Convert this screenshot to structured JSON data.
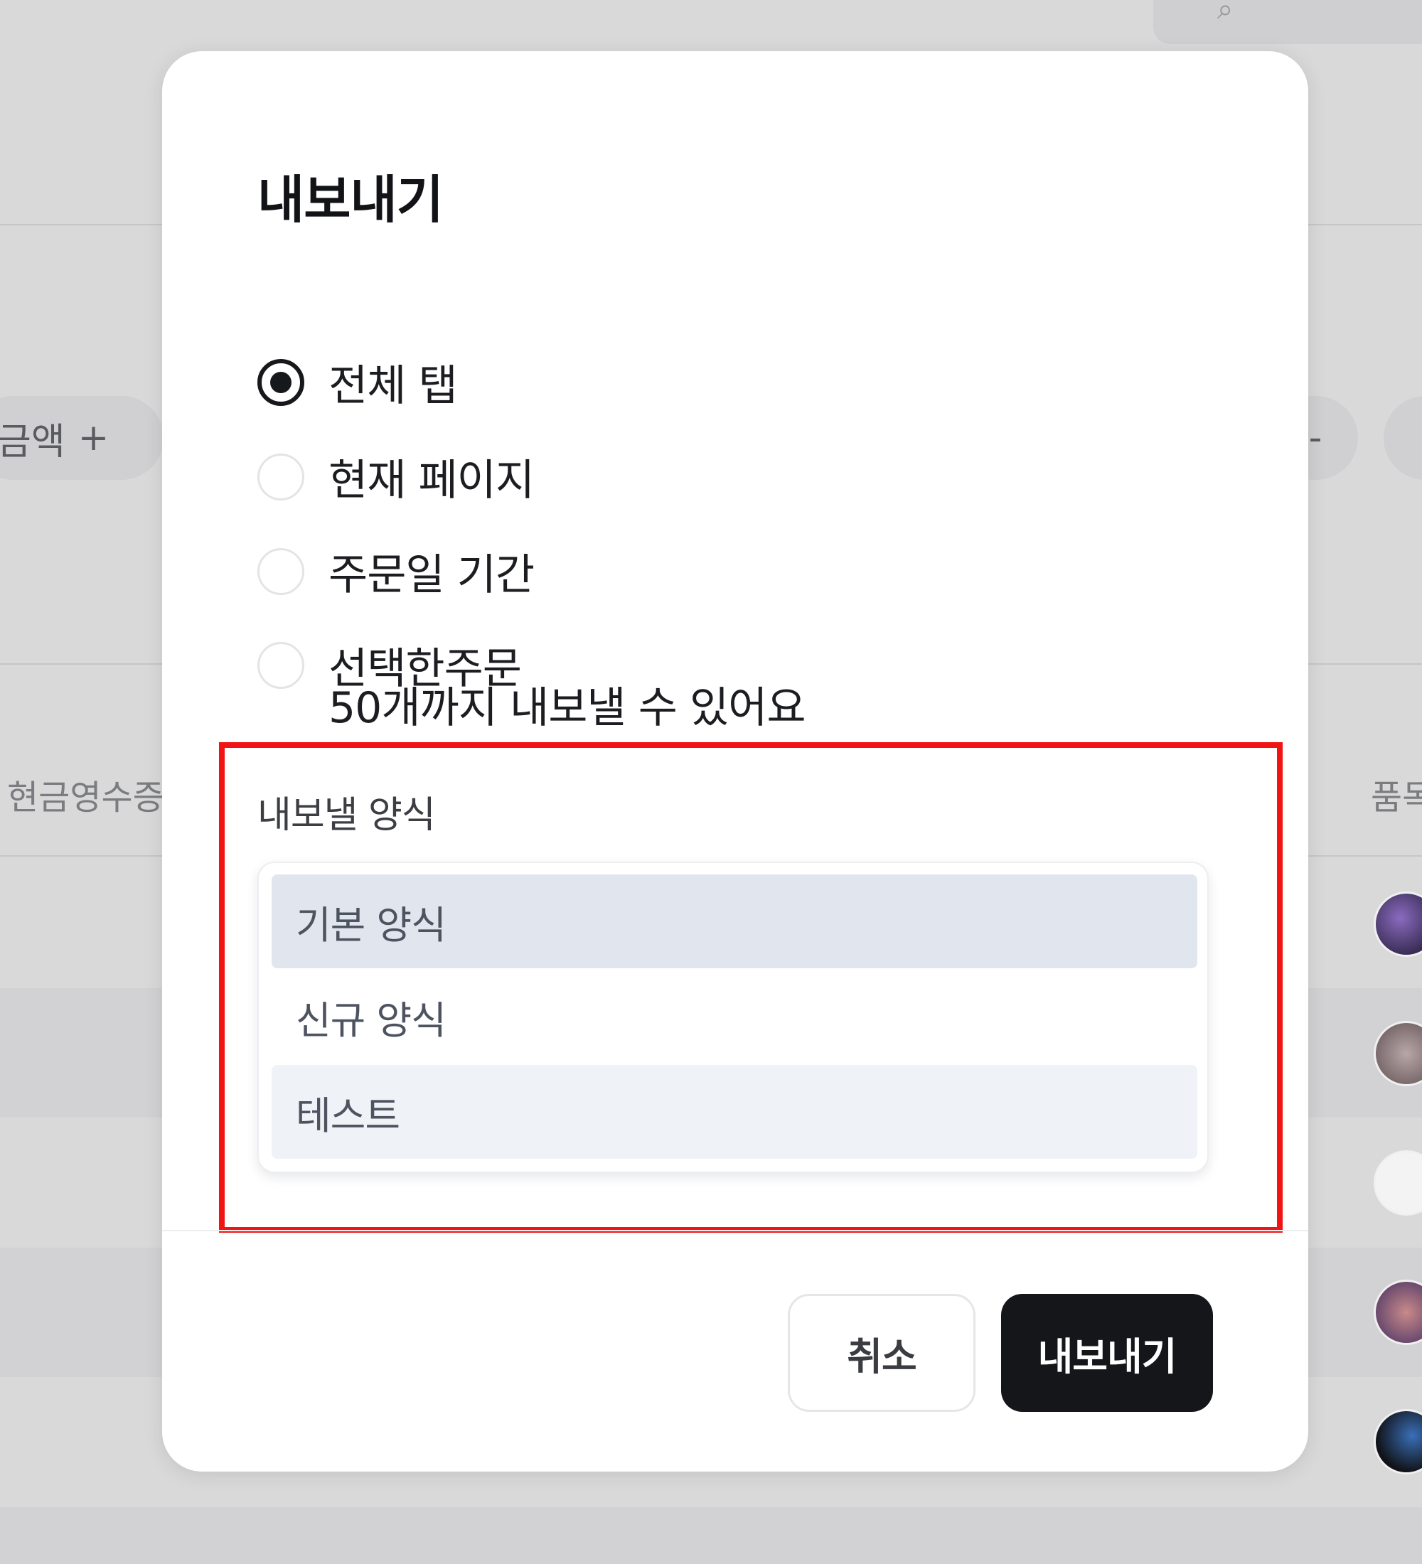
{
  "background": {
    "chip_left_label": "금액",
    "chip_left_icon": "plus-icon",
    "column_header_left": "현금영수증",
    "column_header_right": "품목"
  },
  "modal": {
    "title": "내보내기",
    "scope_options": [
      {
        "label": "전체 탭",
        "checked": true
      },
      {
        "label": "현재 페이지",
        "checked": false
      },
      {
        "label": "주문일 기간",
        "checked": false
      },
      {
        "label": "선택한주문",
        "checked": false
      }
    ],
    "selected_orders_hint": "50개까지 내보낼 수 있어요",
    "format": {
      "label": "내보낼 양식",
      "options": [
        {
          "label": "기본 양식",
          "state": "selected"
        },
        {
          "label": "신규 양식",
          "state": "default"
        },
        {
          "label": "테스트",
          "state": "hovered"
        }
      ]
    },
    "buttons": {
      "cancel": "취소",
      "export": "내보내기"
    }
  },
  "colors": {
    "highlight_border": "#f21314",
    "primary_button": "#15161a",
    "selected_option": "#e1e6ee",
    "hovered_option": "#eff2f7",
    "backdrop": "#d9d9da"
  }
}
